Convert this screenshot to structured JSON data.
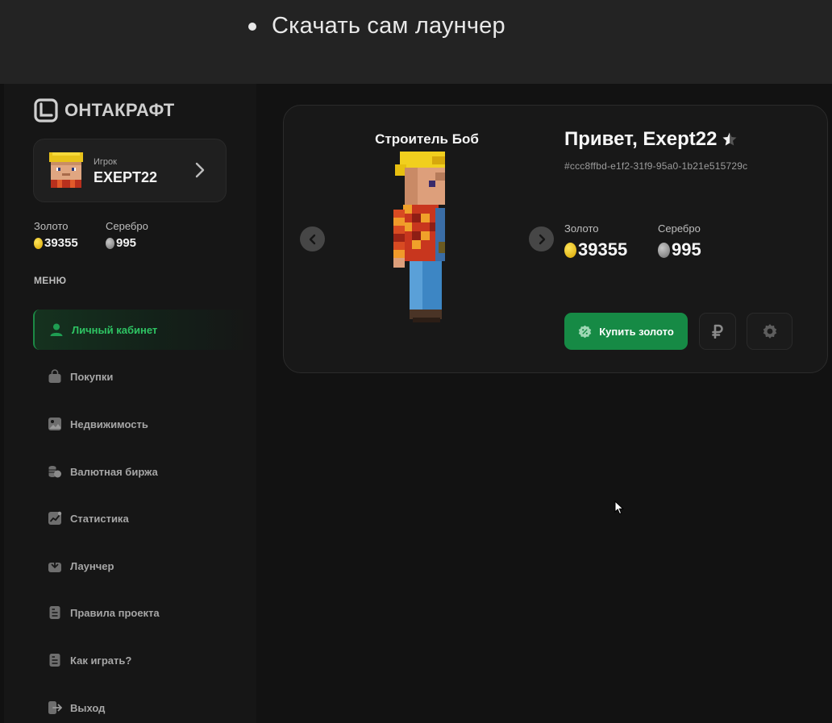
{
  "banner": {
    "bullet_text": "Скачать сам лаунчер"
  },
  "brand": {
    "name": "ОНТАКРАФТ",
    "accent": "#168a45",
    "accent_text": "#2ec463"
  },
  "player": {
    "role": "Игрок",
    "name": "EXEPT22"
  },
  "sidebar_currency": {
    "gold_label": "Золото",
    "gold_value": "39355",
    "silver_label": "Серебро",
    "silver_value": "995"
  },
  "menu": {
    "title": "МЕНЮ",
    "items": [
      {
        "label": "Личный кабинет",
        "icon": "user-icon",
        "active": true
      },
      {
        "label": "Покупки",
        "icon": "bag-icon"
      },
      {
        "label": "Недвижимость",
        "icon": "image-icon"
      },
      {
        "label": "Валютная биржа",
        "icon": "coins-icon"
      },
      {
        "label": "Статистика",
        "icon": "chart-icon"
      },
      {
        "label": "Лаунчер",
        "icon": "download-icon"
      },
      {
        "label": "Правила проекта",
        "icon": "document-icon"
      },
      {
        "label": "Как играть?",
        "icon": "document-icon"
      },
      {
        "label": "Выход",
        "icon": "logout-icon"
      }
    ]
  },
  "profile": {
    "skin_name": "Строитель Боб",
    "greeting": "Привет, Exept22",
    "uuid": "#ccc8ffbd-e1f2-31f9-95a0-1b21e515729c",
    "gold_label": "Золото",
    "gold_value": "39355",
    "silver_label": "Серебро",
    "silver_value": "995",
    "buy_gold_label": "Купить золото"
  }
}
